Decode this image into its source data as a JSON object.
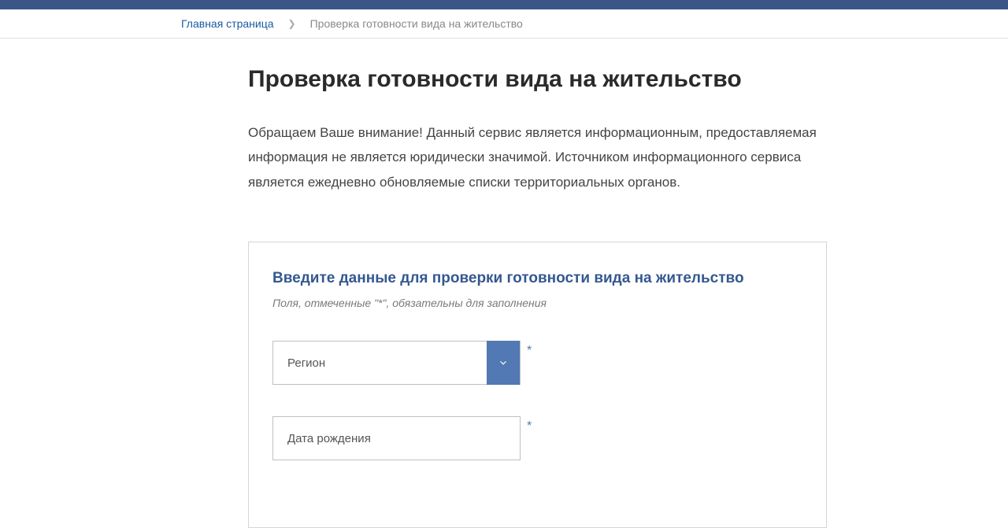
{
  "breadcrumb": {
    "home": "Главная страница",
    "current": "Проверка готовности вида на жительство"
  },
  "page": {
    "title": "Проверка готовности вида на жительство",
    "description": "Обращаем Ваше внимание! Данный сервис является информационным, предоставляемая информация не является юридически значимой. Источником информационного сервиса является ежедневно обновляемые списки территориальных органов."
  },
  "form": {
    "title": "Введите данные для проверки готовности вида на жительство",
    "hint": "Поля, отмеченные \"*\", обязательны для заполнения",
    "region_placeholder": "Регион",
    "dob_placeholder": "Дата рождения",
    "required_mark": "*"
  }
}
